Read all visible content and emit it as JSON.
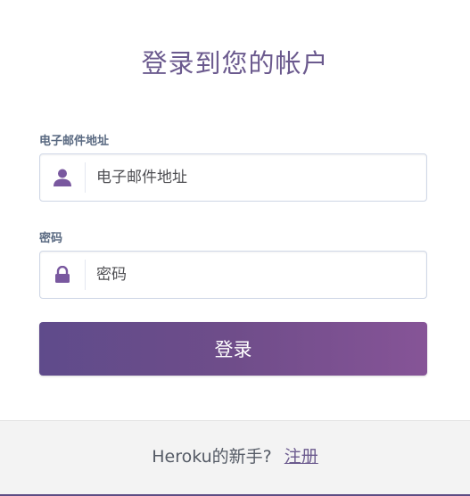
{
  "title": "登录到您的帐户",
  "email": {
    "label": "电子邮件地址",
    "placeholder": "电子邮件地址",
    "icon": "user-icon"
  },
  "password": {
    "label": "密码",
    "placeholder": "密码",
    "icon": "lock-icon"
  },
  "login_button": "登录",
  "footer": {
    "prompt": "Heroku的新手?",
    "signup_link": "注册"
  },
  "colors": {
    "accent": "#6b5a8e",
    "button_start": "#5f4b8b",
    "button_end": "#865497",
    "footer_bg": "#f3f3f3"
  }
}
